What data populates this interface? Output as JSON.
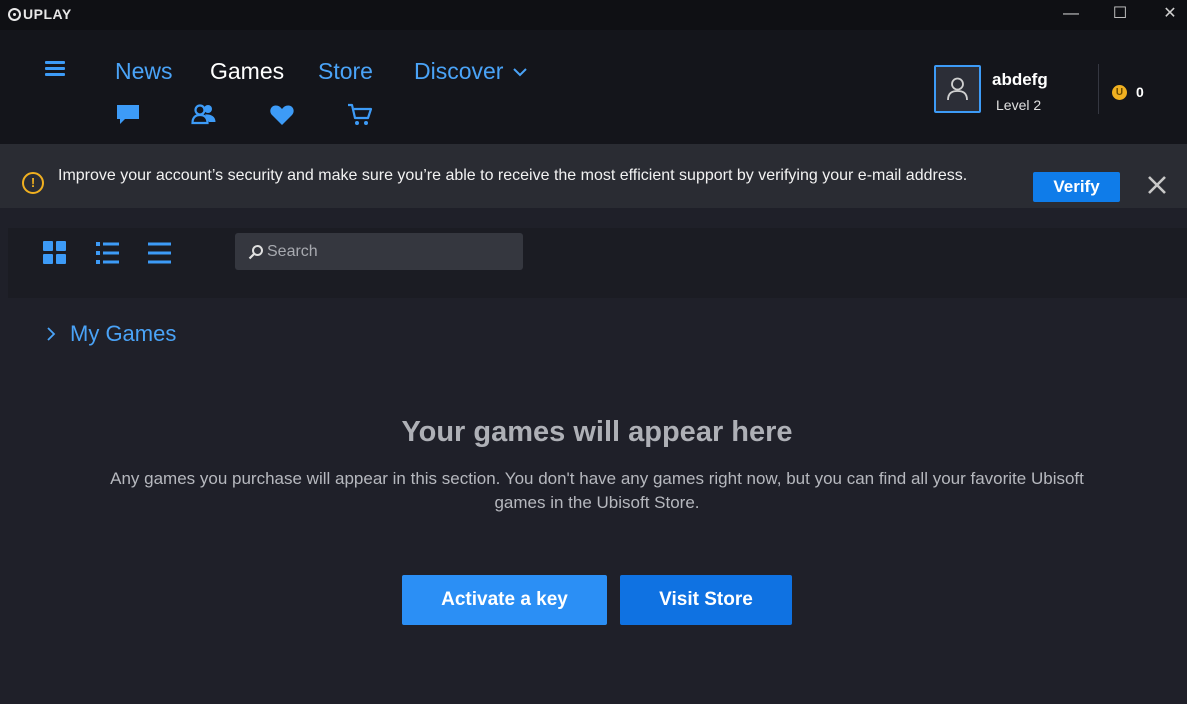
{
  "app": {
    "logo_text": "UPLAY"
  },
  "window": {
    "minimize": "—",
    "maximize": "☐",
    "close": "✕"
  },
  "nav": {
    "links": [
      "News",
      "Games",
      "Store",
      "Discover"
    ],
    "active": "Games",
    "icons": [
      "chat-icon",
      "friends-icon",
      "wishlist-heart-icon",
      "cart-icon"
    ]
  },
  "user": {
    "name": "abdefg",
    "level": "Level 2",
    "coins": "0",
    "coin_symbol": "U"
  },
  "banner": {
    "icon": "!",
    "message": "Improve your account’s security and make sure you’re able to receive the most efficient support by verifying your e-mail address.",
    "verify_label": "Verify"
  },
  "toolbar": {
    "search_placeholder": "Search"
  },
  "section": {
    "title": "My Games"
  },
  "empty": {
    "title": "Your games will appear here",
    "text": "Any games you purchase will appear in this section. You don't have any games right now, but you can find all your favorite Ubisoft games in the Ubisoft Store."
  },
  "actions": {
    "activate_label": "Activate a key",
    "store_label": "Visit Store"
  },
  "colors": {
    "accent": "#3d9bf7",
    "primary_button": "#0f72e2",
    "warning": "#f0b020"
  }
}
